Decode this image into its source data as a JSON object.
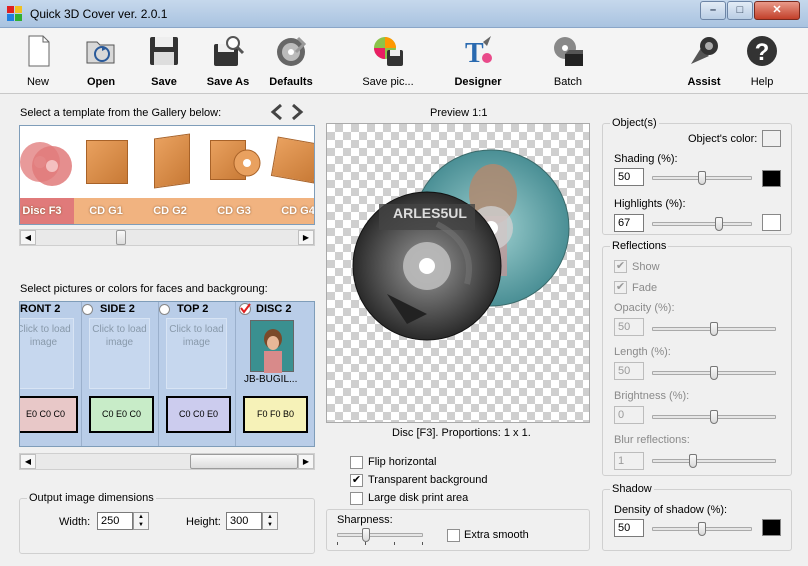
{
  "window": {
    "title": "Quick 3D Cover ver. 2.0.1"
  },
  "toolbar": {
    "new": "New",
    "open": "Open",
    "save": "Save",
    "save_as": "Save As",
    "defaults": "Defaults",
    "save_pic": "Save pic...",
    "designer": "Designer",
    "batch": "Batch",
    "assist": "Assist",
    "help": "Help"
  },
  "gallery": {
    "label": "Select a template from the Gallery below:",
    "items": [
      {
        "label": "Disc F3"
      },
      {
        "label": "CD G1"
      },
      {
        "label": "CD G2"
      },
      {
        "label": "CD G3"
      },
      {
        "label": "CD G4"
      }
    ]
  },
  "faces": {
    "label": "Select pictures or colors for faces and backgroung:",
    "items": [
      {
        "name": "RONT 2",
        "slot": "Click to load image",
        "color": "E0 C0 C0",
        "bg": "#e8c8c8"
      },
      {
        "name": "SIDE 2",
        "slot": "Click to load image",
        "color": "C0 E0 C0",
        "bg": "#c8ecc8"
      },
      {
        "name": "TOP 2",
        "slot": "Click to load image",
        "color": "C0 C0 E0",
        "bg": "#ccccee"
      },
      {
        "name": "DISC 2",
        "slot": "JB-BUGIL...",
        "color": "F0 F0 B0",
        "bg": "#f6f2b8"
      }
    ]
  },
  "output": {
    "title": "Output image dimensions",
    "width_label": "Width:",
    "width": "250",
    "height_label": "Height:",
    "height": "300"
  },
  "preview": {
    "title": "Preview 1:1",
    "caption": "Disc [F3]. Proportions: 1 x 1.",
    "disc_text": "ARLES5UL"
  },
  "options": {
    "flip": "Flip horizontal",
    "transparent": "Transparent background",
    "large_disk": "Large disk print area",
    "sharpness": "Sharpness:",
    "extra_smooth": "Extra smooth"
  },
  "objects": {
    "title": "Object(s)",
    "color_label": "Object's color:",
    "shading_label": "Shading (%):",
    "shading": "50",
    "shading_level": 0.5,
    "highlights_label": "Highlights (%):",
    "highlights": "67",
    "highlights_level": 0.67
  },
  "reflections": {
    "title": "Reflections",
    "show": "Show",
    "fade": "Fade",
    "opacity_label": "Opacity (%):",
    "opacity": "50",
    "opacity_level": 0.5,
    "length_label": "Length (%):",
    "length": "50",
    "length_level": 0.5,
    "brightness_label": "Brightness (%):",
    "brightness": "0",
    "brightness_level": 0.5,
    "blur_label": "Blur reflections:",
    "blur": "1",
    "blur_level": 0.33
  },
  "shadow": {
    "title": "Shadow",
    "density_label": "Density of shadow (%):",
    "density": "50",
    "density_level": 0.5
  },
  "colors": {
    "accent": "#e02020",
    "object_color": "#f0f0f0",
    "shading_color": "#000000",
    "highlights_color": "#ffffff",
    "shadow_color": "#000000"
  }
}
